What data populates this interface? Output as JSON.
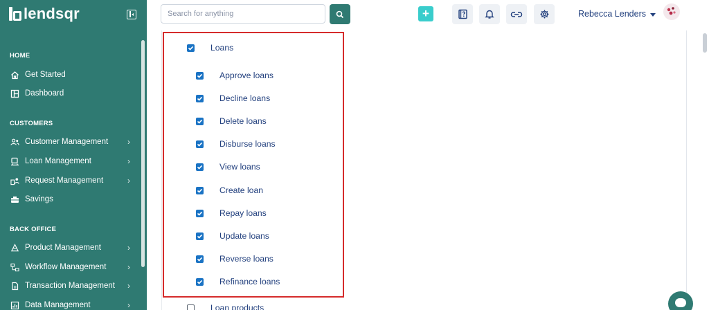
{
  "brand": {
    "name": "lendsqr"
  },
  "sidebar": {
    "sections": [
      {
        "title": "HOME",
        "items": [
          {
            "label": "Get Started",
            "icon": "home-icon",
            "chevron": false
          },
          {
            "label": "Dashboard",
            "icon": "dashboard-icon",
            "chevron": false
          }
        ]
      },
      {
        "title": "CUSTOMERS",
        "items": [
          {
            "label": "Customer Management",
            "icon": "users-icon",
            "chevron": true
          },
          {
            "label": "Loan Management",
            "icon": "loan-icon",
            "chevron": true
          },
          {
            "label": "Request Management",
            "icon": "request-icon",
            "chevron": true
          },
          {
            "label": "Savings",
            "icon": "savings-icon",
            "chevron": false
          }
        ]
      },
      {
        "title": "BACK OFFICE",
        "items": [
          {
            "label": "Product Management",
            "icon": "product-icon",
            "chevron": true
          },
          {
            "label": "Workflow Management",
            "icon": "workflow-icon",
            "chevron": true
          },
          {
            "label": "Transaction Management",
            "icon": "transaction-icon",
            "chevron": true
          },
          {
            "label": "Data Management",
            "icon": "data-icon",
            "chevron": true
          }
        ]
      }
    ]
  },
  "topbar": {
    "search_placeholder": "Search for anything",
    "user_name": "Rebecca Lenders"
  },
  "permissions": {
    "group": {
      "label": "Loans",
      "checked": true
    },
    "items": [
      {
        "label": "Approve loans",
        "checked": true
      },
      {
        "label": "Decline loans",
        "checked": true
      },
      {
        "label": "Delete loans",
        "checked": true
      },
      {
        "label": "Disburse loans",
        "checked": true
      },
      {
        "label": "View loans",
        "checked": true
      },
      {
        "label": "Create loan",
        "checked": true
      },
      {
        "label": "Repay loans",
        "checked": true
      },
      {
        "label": "Update loans",
        "checked": true
      },
      {
        "label": "Reverse loans",
        "checked": true
      },
      {
        "label": "Refinance loans",
        "checked": true
      }
    ],
    "next_group": {
      "label": "Loan products",
      "checked": false
    }
  },
  "colors": {
    "sidebar_bg": "#2f7a72",
    "accent": "#39cdcc",
    "text": "#213f7d",
    "checkbox": "#1a73c4",
    "highlight": "#d52b2b"
  }
}
